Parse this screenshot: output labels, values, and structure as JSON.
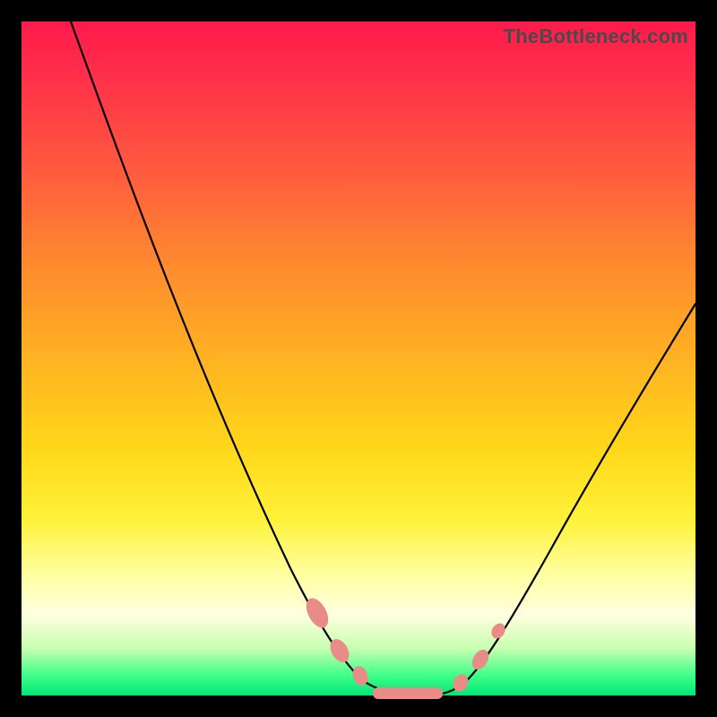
{
  "watermark": "TheBottleneck.com",
  "colors": {
    "background_frame": "#000000",
    "gradient_top": "#ff1a4b",
    "gradient_mid1": "#ff8a2e",
    "gradient_mid2": "#ffd91a",
    "gradient_pale": "#ffffe0",
    "gradient_bottom": "#00e676",
    "curve": "#000000",
    "markers": "#e98b86"
  },
  "chart_data": {
    "type": "line",
    "title": "",
    "xlabel": "",
    "ylabel": "",
    "xlim": [
      0,
      100
    ],
    "ylim": [
      0,
      100
    ],
    "x": [
      0,
      5,
      10,
      15,
      20,
      25,
      30,
      35,
      40,
      45,
      48,
      50,
      52,
      55,
      58,
      60,
      62,
      65,
      70,
      75,
      80,
      85,
      90,
      95,
      100
    ],
    "y": [
      100,
      92,
      83,
      74,
      64,
      54,
      44,
      34,
      24,
      13,
      7,
      3,
      1,
      0,
      0,
      0,
      1,
      4,
      12,
      22,
      32,
      41,
      49,
      56,
      62
    ],
    "marker_points": [
      {
        "x": 46,
        "y": 10
      },
      {
        "x": 48,
        "y": 6
      },
      {
        "x": 50,
        "y": 2
      },
      {
        "x": 55,
        "y": 0
      },
      {
        "x": 58,
        "y": 0
      },
      {
        "x": 62,
        "y": 1
      },
      {
        "x": 65,
        "y": 4
      },
      {
        "x": 67,
        "y": 8
      }
    ],
    "description": "V-shaped bottleneck curve: steep descent from top-left to a flat minimum around x≈55–60, then a shallower rise toward the right edge. Background is a red→green vertical gradient indicating worse (top) to better (bottom). Salmon markers highlight the near-zero region."
  }
}
